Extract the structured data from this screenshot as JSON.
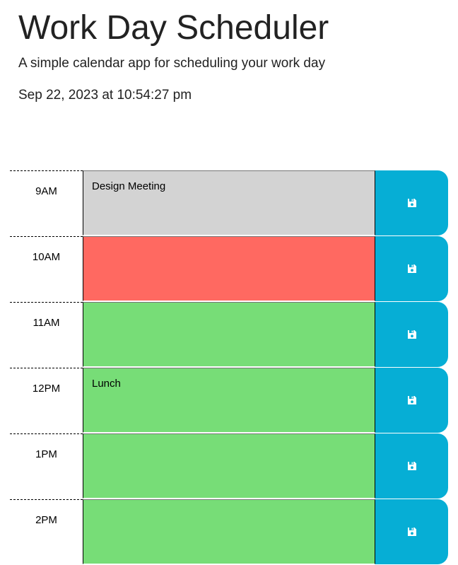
{
  "header": {
    "title": "Work Day Scheduler",
    "subtitle": "A simple calendar app for scheduling your work day",
    "current_datetime": "Sep 22, 2023 at 10:54:27 pm"
  },
  "colors": {
    "past": "#d3d3d3",
    "present": "#ff6961",
    "future": "#77dd77",
    "save_button": "#06aed5"
  },
  "time_blocks": [
    {
      "hour": "9AM",
      "text": "Design Meeting",
      "status": "past",
      "save_icon": "floppy-disk-icon"
    },
    {
      "hour": "10AM",
      "text": "",
      "status": "present",
      "save_icon": "floppy-disk-icon"
    },
    {
      "hour": "11AM",
      "text": "",
      "status": "future",
      "save_icon": "floppy-disk-icon"
    },
    {
      "hour": "12PM",
      "text": "Lunch",
      "status": "future",
      "save_icon": "floppy-disk-icon"
    },
    {
      "hour": "1PM",
      "text": "",
      "status": "future",
      "save_icon": "floppy-disk-icon"
    },
    {
      "hour": "2PM",
      "text": "",
      "status": "future",
      "save_icon": "floppy-disk-icon"
    }
  ]
}
